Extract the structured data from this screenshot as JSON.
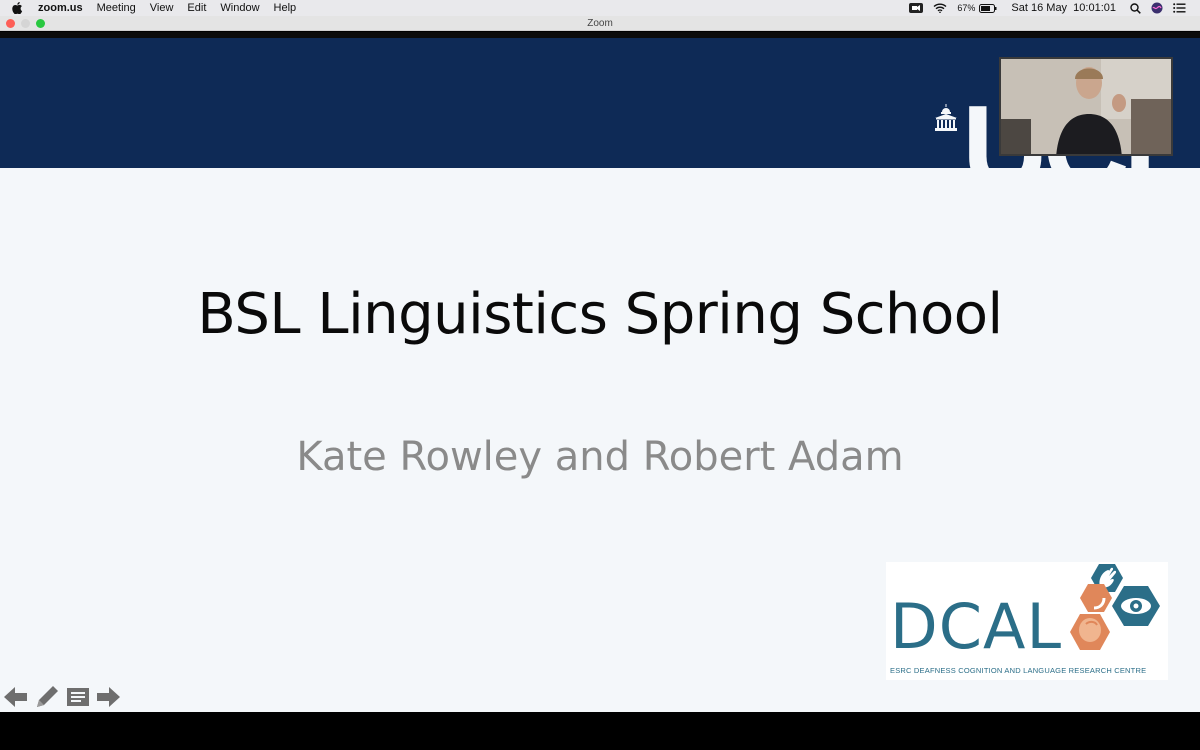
{
  "menubar": {
    "apple_icon": "apple-icon",
    "app_name": "zoom.us",
    "items": [
      "Meeting",
      "View",
      "Edit",
      "Window",
      "Help"
    ],
    "battery_percent": "67%",
    "datetime": "Sat 16 May  10:01:01"
  },
  "window": {
    "title": "Zoom"
  },
  "slide": {
    "title": "BSL Linguistics Spring School",
    "subtitle": "Kate Rowley and Robert Adam",
    "banner_color": "#0e2a56",
    "logo_text": "UCL",
    "dcal": {
      "name": "DCAL",
      "tagline": "ESRC DEAFNESS COGNITION AND LANGUAGE RESEARCH CENTRE",
      "colors": {
        "blue": "#2b6e88",
        "orange": "#e0875a"
      }
    }
  },
  "slide_controls": [
    "previous-slide-icon",
    "pen-icon",
    "notes-icon",
    "next-slide-icon"
  ]
}
